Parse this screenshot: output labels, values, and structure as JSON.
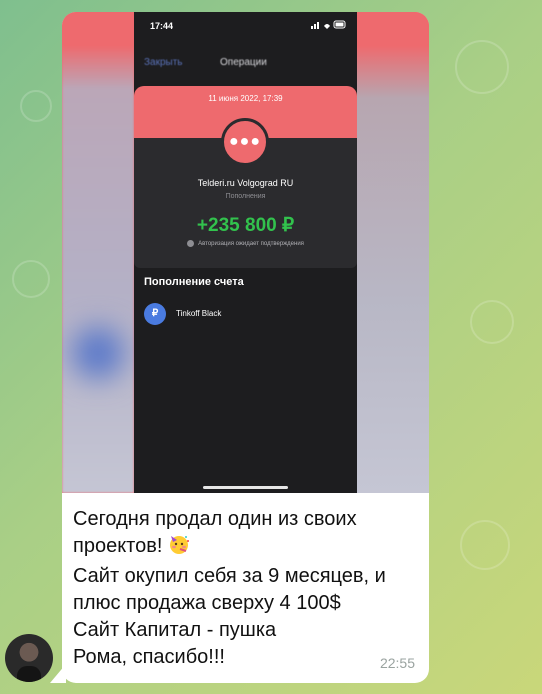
{
  "sender": {
    "avatar": "avatar"
  },
  "screenshot": {
    "status_bar": {
      "time": "17:44",
      "icons": "signal-wifi-battery"
    },
    "nav": {
      "close_label": "Закрыть",
      "title": "Операции"
    },
    "operation": {
      "date": "11 июня 2022, 17:39",
      "merchant": "Telderi.ru Volgograd RU",
      "category": "Пополнения",
      "amount": "+235 800 ₽",
      "status": "Авторизация ожидает подтверждения"
    },
    "section_title": "Пополнение счета",
    "account": {
      "icon": "ruble-icon",
      "icon_glyph": "₽",
      "name": "Tinkoff Black"
    }
  },
  "message": {
    "lines": [
      "Сегодня продал один из своих",
      "проектов!",
      "Сайт окупил себя за 9 месяцев, и",
      "плюс продажа сверху 4 100$",
      "Сайт Капитал - пушка",
      "Рома, спасибо!!!"
    ],
    "emoji": "partying-face-emoji",
    "time": "22:55"
  },
  "colors": {
    "accent_coral": "#ee6a6e",
    "amount_green": "#32c24d",
    "background_green": "#8fc58a"
  }
}
